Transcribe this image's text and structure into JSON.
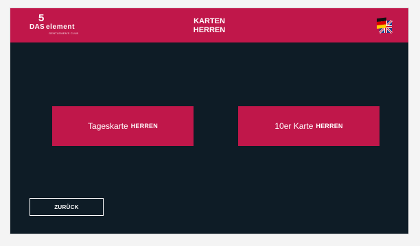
{
  "app": {
    "logo_number": "5",
    "logo_das": "DAS",
    "logo_element": "element",
    "logo_subtitle": "GENTLEMEN'S CLUB"
  },
  "header": {
    "title_line1": "KARTEN",
    "title_line2": "HERREN",
    "language_icon": "flag-de-uk-icon"
  },
  "tiles": [
    {
      "label": "Tageskarte",
      "suffix": "HERREN"
    },
    {
      "label": "10er Karte",
      "suffix": "HERREN"
    }
  ],
  "footer": {
    "back_label": "ZURÜCK"
  },
  "colors": {
    "brand": "#c0174a",
    "background": "#0e1c26",
    "page": "#f4f4f4"
  }
}
